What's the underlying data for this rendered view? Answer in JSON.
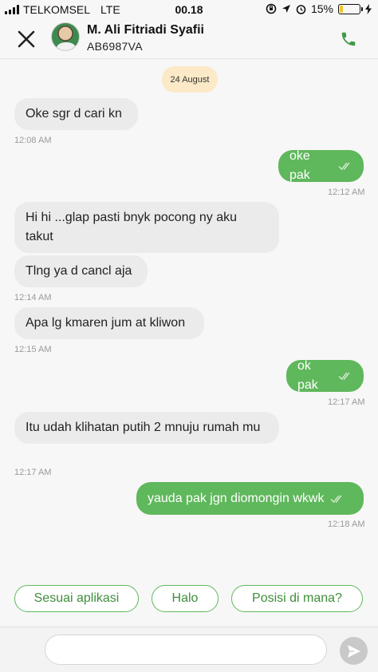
{
  "status_bar": {
    "carrier": "TELKOMSEL",
    "network": "LTE",
    "time": "00.18",
    "battery_percent": "15%",
    "battery_level": 0.15,
    "battery_color": "#f3c52a"
  },
  "header": {
    "close_icon": "close-icon",
    "contact_name": "M. Ali Fitriadi Syafii",
    "license_plate": "AB6987VA",
    "call_icon": "phone-icon"
  },
  "chat": {
    "date_label": "24 August",
    "messages": [
      {
        "direction": "in",
        "text": "Oke sgr d cari kn",
        "time": "12:08 AM"
      },
      {
        "direction": "out",
        "text": "oke pak",
        "time": "12:12 AM",
        "read": true
      },
      {
        "direction": "in",
        "text": "Hi hi ...glap pasti bnyk pocong ny aku takut",
        "time": ""
      },
      {
        "direction": "in",
        "text": "Tlng ya d cancl aja",
        "time": "12:14 AM"
      },
      {
        "direction": "in",
        "text": "Apa lg kmaren jum at kliwon",
        "time": "12:15 AM"
      },
      {
        "direction": "out",
        "text": "ok pak",
        "time": "12:17 AM",
        "read": true
      },
      {
        "direction": "in",
        "text": "Itu udah klihatan putih 2 mnuju rumah mu",
        "time": "12:17 AM"
      },
      {
        "direction": "out",
        "text": "yauda pak jgn diomongin wkwk",
        "time": "12:18 AM",
        "read": true
      }
    ]
  },
  "quick_replies": [
    "Sesuai aplikasi",
    "Halo",
    "Posisi di mana?"
  ],
  "composer": {
    "placeholder": "",
    "send_icon": "send-icon"
  },
  "colors": {
    "accent_green": "#5fb85c",
    "incoming_bubble": "#ebebeb",
    "date_chip": "#fbe9c7"
  }
}
